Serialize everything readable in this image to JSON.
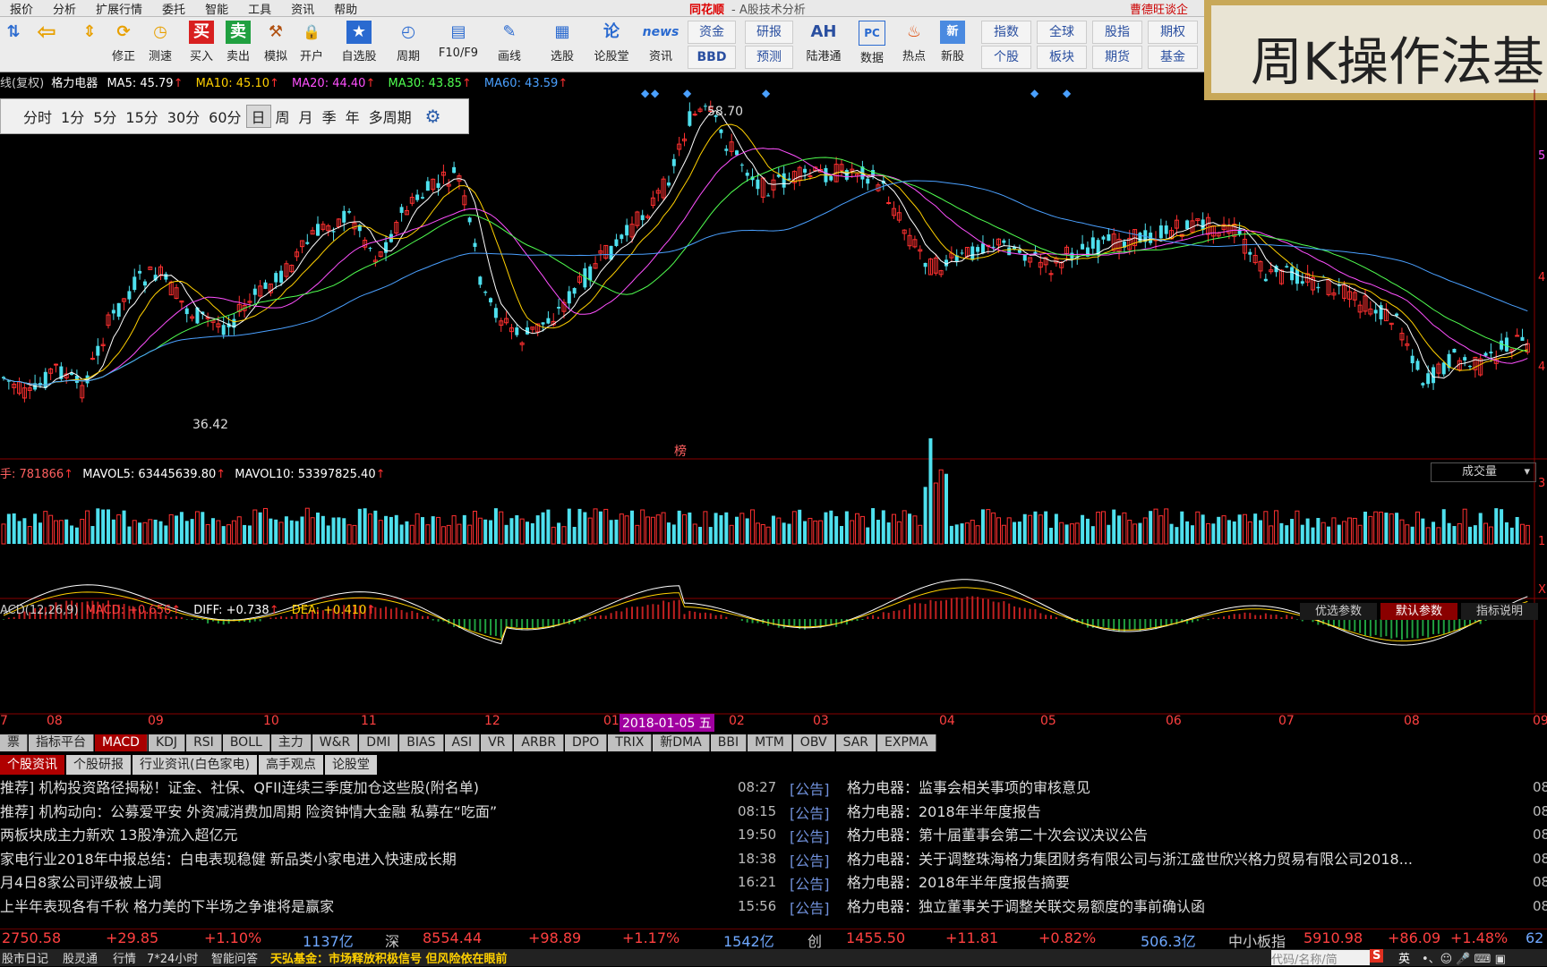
{
  "menu": {
    "items": [
      "报价",
      "分析",
      "扩展行情",
      "委托",
      "智能",
      "工具",
      "资讯",
      "帮助"
    ],
    "app_brand": "同花顺",
    "app_title": "- A股技术分析",
    "right_text": "曹德旺谈企"
  },
  "toolbar": {
    "buttons": [
      {
        "icon": "up-down-arrows-icon",
        "label": "",
        "glyph": "⇅"
      },
      {
        "icon": "back-arrow-icon",
        "label": "",
        "glyph": "⇦"
      },
      {
        "icon": "fix-icon",
        "label": "修正",
        "glyph": "⟳"
      },
      {
        "icon": "clock-icon",
        "label": "测速",
        "glyph": "◷"
      },
      {
        "icon": "buy-icon",
        "label": "买入",
        "glyph": "买"
      },
      {
        "icon": "sell-icon",
        "label": "卖出",
        "glyph": "卖"
      },
      {
        "icon": "hammer-icon",
        "label": "模拟",
        "glyph": "⚒"
      },
      {
        "icon": "lock-icon",
        "label": "开户",
        "glyph": "🔒"
      },
      {
        "icon": "watchlist-icon",
        "label": "自选股",
        "glyph": "★"
      },
      {
        "icon": "period-icon",
        "label": "周期",
        "glyph": "◴"
      },
      {
        "icon": "f10-icon",
        "label": "F10/F9",
        "glyph": "▤"
      },
      {
        "icon": "draw-line-icon",
        "label": "画线",
        "glyph": "✎"
      },
      {
        "icon": "stock-picker-icon",
        "label": "选股",
        "glyph": "▦"
      },
      {
        "icon": "forum-icon",
        "label": "论股堂",
        "glyph": "论"
      },
      {
        "icon": "news-icon",
        "label": "资讯",
        "glyph": "news"
      }
    ],
    "grid_buttons": [
      [
        "资金",
        "研报"
      ],
      [
        "BBD",
        "预测"
      ]
    ],
    "ah_label": "陆港通",
    "ah_glyph": "AH",
    "data_label": "数据",
    "hot_label": "热点",
    "new_label": "新股",
    "right_grid": [
      [
        "指数",
        "全球",
        "股指",
        "期权"
      ],
      [
        "个股",
        "板块",
        "期货",
        "基金"
      ]
    ]
  },
  "overlay_title": "周K操作法基",
  "ma_line": {
    "prefix": "线(复权)",
    "stock": "格力电器",
    "ma5": "MA5: 45.79",
    "ma10": "MA10: 45.10",
    "ma20": "MA20: 44.40",
    "ma30": "MA30: 43.85",
    "ma60": "MA60: 43.59"
  },
  "periods": [
    "分时",
    "1分",
    "5分",
    "15分",
    "30分",
    "60分",
    "日",
    "周",
    "月",
    "季",
    "年",
    "多周期"
  ],
  "price_chart": {
    "high_label": "58.70",
    "low_label": "36.42",
    "marker_label": "榜",
    "right_ticks": [
      "5",
      "4",
      "4"
    ],
    "colors": {
      "up": "#ff3030",
      "down": "#4ee0ee",
      "ma5": "#ffffff",
      "ma10": "#ffd000",
      "ma20": "#ff50ff",
      "ma30": "#50ff50",
      "ma60": "#4aa0ff"
    }
  },
  "volume": {
    "header_prefix": "手: 781866",
    "mavol5": "MAVOL5: 63445639.80",
    "mavol10": "MAVOL10: 53397825.40",
    "dropdown": "成交量",
    "right_ticks": [
      "3",
      "1",
      "X"
    ]
  },
  "macd": {
    "header": "ACD(12,26,9)",
    "macd": "MACD: +0.656",
    "diff": "DIFF: +0.738",
    "dea": "DEA: +0.410",
    "buttons": [
      "优选参数",
      "默认参数",
      "指标说明"
    ]
  },
  "xaxis": {
    "months": [
      "7",
      "08",
      "09",
      "10",
      "11",
      "12",
      "01",
      "02",
      "03",
      "04",
      "05",
      "06",
      "07",
      "08",
      "09"
    ],
    "cursor_date": "2018-01-05 五"
  },
  "indicator_tabs": [
    "票",
    "指标平台",
    "MACD",
    "KDJ",
    "RSI",
    "BOLL",
    "主力",
    "W&R",
    "DMI",
    "BIAS",
    "ASI",
    "VR",
    "ARBR",
    "DPO",
    "TRIX",
    "新DMA",
    "BBI",
    "MTM",
    "OBV",
    "SAR",
    "EXPMA"
  ],
  "news_tabs": [
    "个股资讯",
    "个股研报",
    "行业资讯(白色家电)",
    "高手观点",
    "论股堂"
  ],
  "news_left": [
    "推荐] 机构投资路径揭秘！证金、社保、QFII连续三季度加仓这些股(附名单)",
    "推荐] 机构动向：公募爱平安 外资减消费加周期 险资钟情大金融 私募在“吃面”",
    "两板块成主力新欢 13股净流入超亿元",
    "家电行业2018年中报总结：白电表现稳健 新品类小家电进入快速成长期",
    "月4日8家公司评级被上调",
    "上半年表现各有千秋 格力美的下半场之争谁将是赢家"
  ],
  "news_right": [
    {
      "time": "08:27",
      "tag": "[公告]",
      "text": "格力电器：监事会相关事项的审核意见"
    },
    {
      "time": "08:15",
      "tag": "[公告]",
      "text": "格力电器：2018年半年度报告"
    },
    {
      "time": "19:50",
      "tag": "[公告]",
      "text": "格力电器：第十届董事会第二十次会议决议公告"
    },
    {
      "time": "18:38",
      "tag": "[公告]",
      "text": "格力电器：关于调整珠海格力集团财务有限公司与浙江盛世欣兴格力贸易有限公司2018..."
    },
    {
      "time": "16:21",
      "tag": "[公告]",
      "text": "格力电器：2018年半年度报告摘要"
    },
    {
      "time": "15:56",
      "tag": "[公告]",
      "text": "格力电器：独立董事关于调整关联交易额度的事前确认函"
    }
  ],
  "news_right_edge": [
    "08",
    "08",
    "08",
    "08",
    "08",
    "08"
  ],
  "index_bar": {
    "sh_val": "2750.58",
    "sh_chg": "+29.85",
    "sh_pct": "+1.10%",
    "sh_amt": "1137亿",
    "sz_name": "深",
    "sz_val": "8554.44",
    "sz_chg": "+98.89",
    "sz_pct": "+1.17%",
    "sz_amt": "1542亿",
    "cy_name": "创",
    "cy_val": "1455.50",
    "cy_chg": "+11.81",
    "cy_pct": "+0.82%",
    "cy_amt": "506.3亿",
    "zx_name": "中小板指",
    "zx_val": "5910.98",
    "zx_chg": "+86.09",
    "zx_pct": "+1.48%",
    "zx_amt": "62"
  },
  "status_bar": {
    "items": [
      "股市日记",
      "股灵通",
      "行情",
      "7*24小时",
      "智能问答"
    ],
    "ticker": "天弘基金：市场释放积极信号 但风险依在眼前",
    "search_placeholder": "代码/名称/简",
    "ime": "英"
  }
}
